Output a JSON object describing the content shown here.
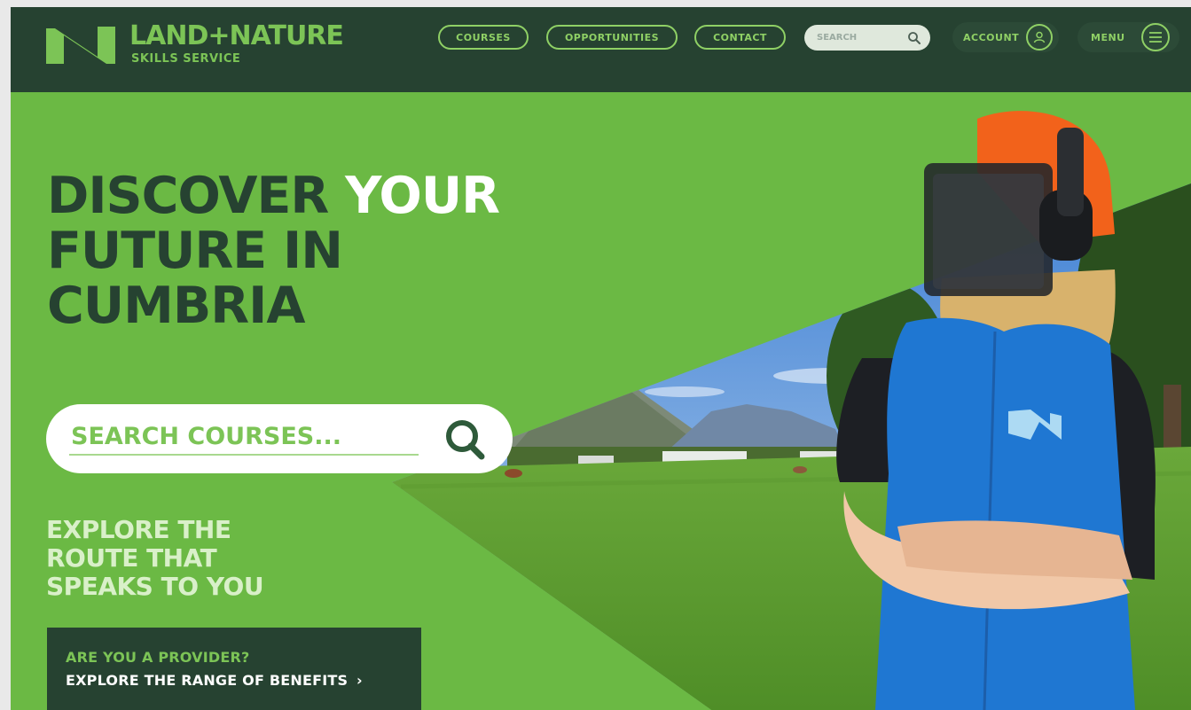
{
  "header": {
    "logo_title": "LAND+NATURE",
    "logo_subtitle": "SKILLS SERVICE",
    "nav": [
      {
        "label": "COURSES"
      },
      {
        "label": "OPPORTUNITIES"
      },
      {
        "label": "CONTACT"
      }
    ],
    "search_placeholder": "SEARCH",
    "account_label": "ACCOUNT",
    "menu_label": "MENU",
    "icons": {
      "search": "search-icon",
      "account": "user-icon",
      "menu": "hamburger-icon"
    }
  },
  "hero": {
    "headline_part1": "DISCOVER ",
    "headline_accent": "YOUR",
    "headline_line2": "FUTURE IN",
    "headline_line3": "CUMBRIA",
    "search_placeholder": "SEARCH COURSES...",
    "explore_line1": "EXPLORE THE",
    "explore_line2": "ROUTE THAT",
    "explore_line3": "SPEAKS TO YOU",
    "provider_question": "ARE YOU A PROVIDER?",
    "provider_cta": "EXPLORE THE RANGE OF BENEFITS",
    "provider_arrow": "›"
  },
  "colors": {
    "header_bg": "#264231",
    "brand_green": "#6bb944",
    "accent_green": "#8fd065",
    "dark_text": "#264231",
    "white": "#ffffff"
  }
}
